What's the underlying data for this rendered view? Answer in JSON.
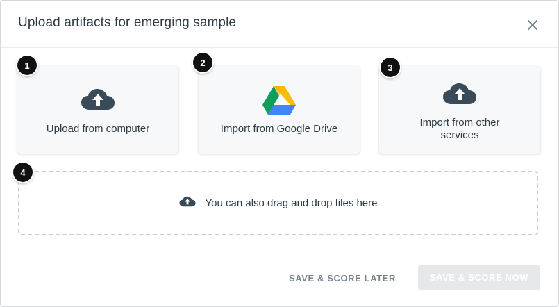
{
  "modal": {
    "title": "Upload artifacts for emerging sample",
    "close_icon": "close-icon"
  },
  "options": [
    {
      "badge": "1",
      "label": "Upload from computer",
      "icon": "cloud-upload-icon"
    },
    {
      "badge": "2",
      "label": "Import from Google Drive",
      "icon": "google-drive-icon"
    },
    {
      "badge": "3",
      "label_line1": "Import from other",
      "label_line2": "services",
      "icon": "cloud-upload-icon"
    }
  ],
  "dropzone": {
    "badge": "4",
    "text": "You can also drag and drop files here",
    "icon": "cloud-upload-icon"
  },
  "footer": {
    "save_later_label": "SAVE & SCORE LATER",
    "save_now_label": "SAVE & SCORE NOW"
  },
  "colors": {
    "text": "#2d3b45",
    "icon": "#394b58",
    "badge": "#111111",
    "muted_button_text": "#73818c",
    "disabled_button_bg": "#e6e8ea"
  }
}
